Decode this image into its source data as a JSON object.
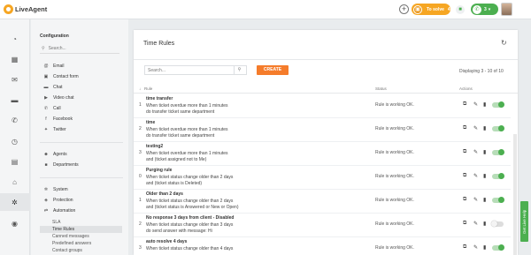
{
  "app": {
    "logo_text": "LiveAgent"
  },
  "topbar": {
    "add_glyph": "+",
    "to_solve_label": "To solve",
    "to_solve_count": "4",
    "status_count": "3",
    "colors": {
      "to_solve": "#f6a623",
      "status": "#4caf50"
    }
  },
  "sidebar": {
    "title": "Configuration",
    "search_placeholder": "Search...",
    "items": [
      {
        "label": "Email",
        "icon": "at-icon"
      },
      {
        "label": "Contact form",
        "icon": "form-icon"
      },
      {
        "label": "Chat",
        "icon": "chat-bubble-icon"
      },
      {
        "label": "Video chat",
        "icon": "video-icon"
      },
      {
        "label": "Call",
        "icon": "phone-icon"
      },
      {
        "label": "Facebook",
        "icon": "facebook-icon"
      },
      {
        "label": "Twitter",
        "icon": "twitter-icon"
      },
      {
        "label": "Agents",
        "icon": "agents-icon"
      },
      {
        "label": "Departments",
        "icon": "folder-icon"
      },
      {
        "label": "System",
        "icon": "gear-icon"
      },
      {
        "label": "Protection",
        "icon": "shield-icon"
      },
      {
        "label": "Automation",
        "icon": "automation-icon"
      }
    ],
    "subitems": [
      "SLA",
      "Time Rules",
      "Canned messages",
      "Predefined answers",
      "Contact groups"
    ]
  },
  "main": {
    "title": "Time Rules",
    "search_placeholder": "Search...",
    "create_label": "CREATE",
    "displaying": "Displaying 3 - 10 of 10",
    "columns": {
      "rule": "Rule",
      "status": "Status",
      "actions": "Actions"
    },
    "sort_indicator": "↓",
    "rows": [
      {
        "num": "1",
        "name": "time transfer",
        "desc1": "When ticket overdue more than 1 minutes",
        "desc2": "do transfer ticket same department",
        "status": "Rule is working OK.",
        "enabled": true
      },
      {
        "num": "2",
        "name": "time",
        "desc1": "When ticket overdue more than 1 minutes",
        "desc2": "do transfer ticket same department",
        "status": "Rule is working OK.",
        "enabled": true
      },
      {
        "num": "3",
        "name": "testing2",
        "desc1": "When ticket overdue more than 1 minutes",
        "desc2": "and (ticket assigned not to Me)",
        "status": "Rule is working OK.",
        "enabled": true
      },
      {
        "num": "0",
        "name": "Purging rule",
        "desc1": "When ticket status change older than 2 days",
        "desc2": "and (ticket status is Deleted)",
        "status": "Rule is working OK.",
        "enabled": true
      },
      {
        "num": "1",
        "name": "Older than 2 days",
        "desc1": "When ticket status change older than 2 days",
        "desc2": "and (ticket status is Answered or New or Open)",
        "status": "Rule is working OK.",
        "enabled": true
      },
      {
        "num": "2",
        "name": "No response 3 days from client - Disabled",
        "desc1": "When ticket status change older than 3 days",
        "desc2": "do send answer with message: Hi",
        "status": "Rule is working OK.",
        "enabled": false
      },
      {
        "num": "3",
        "name": "auto resolve 4 days",
        "desc1": "When ticket status change older than 4 days",
        "desc2": "",
        "status": "Rule is working OK.",
        "enabled": true
      }
    ]
  },
  "help_tab": "Get Live Help"
}
